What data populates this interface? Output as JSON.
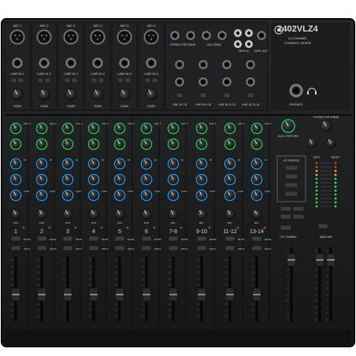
{
  "product": {
    "model": "1402VLZ4",
    "brand_line1": "14-CHANNEL",
    "brand_line2": "COMPACT MIXER"
  },
  "top_channels": [
    {
      "mic": "MIC 1",
      "line": "LINE IN 1"
    },
    {
      "mic": "MIC 2",
      "line": "LINE IN 2"
    },
    {
      "mic": "MIC 3",
      "line": "LINE IN 3"
    },
    {
      "mic": "MIC 4",
      "line": "LINE IN 4"
    },
    {
      "mic": "MIC 5",
      "line": "LINE IN 5"
    },
    {
      "mic": "MIC 6",
      "line": "LINE IN 6"
    }
  ],
  "gain_label": "GAIN",
  "rear_labels": {
    "stereo_returns": "STEREO RETURNS",
    "aux_send": "AUX SEND",
    "tape_in": "TAPE IN",
    "tape_out": "TAPE OUT",
    "line_in_78": "LINE IN 7-8",
    "line_in_910": "LINE IN 9-10",
    "line_in_1112": "LINE IN 11-12",
    "line_in_1314": "LINE IN 13-14",
    "phones": "PHONES"
  },
  "strip_labels": [
    "1",
    "2",
    "3",
    "4",
    "5",
    "6",
    "7-8",
    "9-10",
    "11-12",
    "13-14"
  ],
  "knob_labels": {
    "aux1": "AUX 1",
    "aux2": "AUX 2",
    "eq_hi": "HI",
    "eq_mid": "MID",
    "eq_low": "LOW",
    "pan": "PAN",
    "bal": "BAL",
    "mute": "MUTE",
    "solo": "SOLO"
  },
  "master": {
    "aux_returns": "AUX 1 RETURN",
    "stereo_returns": "STEREO RETURNS",
    "cr_source": "CR SOURCE",
    "main_mix": "MAIN MIX",
    "left": "LEFT",
    "right": "RIGHT",
    "phones_level": "PHONES",
    "subgroups": "CR / SUBMIX"
  },
  "colors": {
    "panel": "#1b1c1e",
    "panel_edge": "#0c0c0d",
    "knob_green": "#2fbf57",
    "knob_blue": "#2a8fd6",
    "knob_cap": "#1e1f21",
    "led_green": "#3ddc5a",
    "led_red": "#e03a2f",
    "led_amber": "#f0b429"
  }
}
